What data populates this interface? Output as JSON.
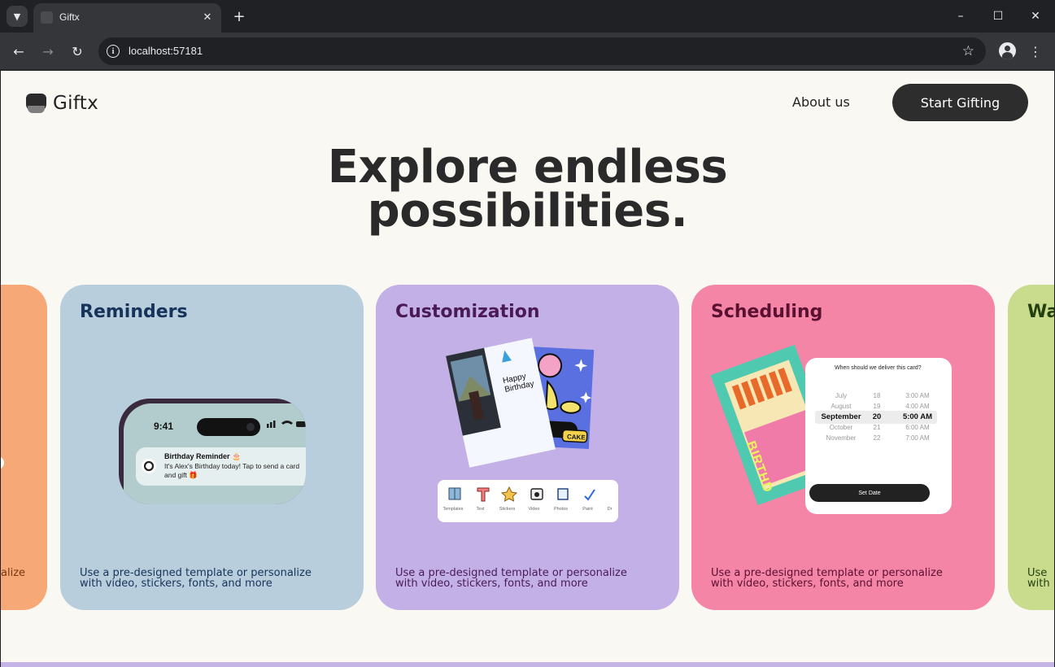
{
  "browser": {
    "tab_title": "Giftx",
    "url": "localhost:57181",
    "icons": [
      "tab-search-icon",
      "close-icon",
      "plus-icon",
      "minimize-icon",
      "maximize-icon",
      "window-close-icon",
      "back-arrow-icon",
      "forward-arrow-icon",
      "reload-icon",
      "info-icon",
      "star-icon",
      "profile-icon",
      "kebab-menu-icon"
    ]
  },
  "header": {
    "brand": "Giftx",
    "nav_about": "About us",
    "cta_label": "Start Gifting"
  },
  "hero": {
    "line1": "Explore endless",
    "line2": "possibilities."
  },
  "cards": [
    {
      "title": "",
      "desc_line1": "Use a pre-designed template or personalize",
      "desc_visible": "alize",
      "color": "#f7a877",
      "text_color": "#7a3510"
    },
    {
      "title": "Reminders",
      "desc_line1": "Use a pre-designed template or personalize",
      "desc_line2": "with video, stickers, fonts, and more",
      "color": "#b8cedd",
      "text_color": "#17335a",
      "phone": {
        "time": "9:41",
        "notif_title": "Birthday Reminder 🎂",
        "notif_body": "It's Alex's Birthday today! Tap to send a card and gift 🎁"
      }
    },
    {
      "title": "Customization",
      "desc_line1": "Use a pre-designed template or personalize",
      "desc_line2": "with video, stickers, fonts, and more",
      "color": "#c3b0e6",
      "text_color": "#4a1a55",
      "card_text": "Happy Birthday",
      "cake_text": "CAKE",
      "tools": [
        "Templates",
        "Text",
        "Stickers",
        "Video",
        "Photos",
        "Paint",
        "Dr"
      ]
    },
    {
      "title": "Scheduling",
      "desc_line1": "Use a pre-designed template or personalize",
      "desc_line2": "with video, stickers, fonts, and more",
      "color": "#f585a6",
      "text_color": "#5a1030",
      "picker": {
        "question": "When should we deliver this card?",
        "months": [
          "July",
          "August",
          "September",
          "October",
          "November"
        ],
        "days": [
          "18",
          "19",
          "20",
          "21",
          "22"
        ],
        "times": [
          "3:00 AM",
          "4:00 AM",
          "5:00 AM",
          "6:00 AM",
          "7:00 AM"
        ],
        "button": "Set Date"
      },
      "card_text": "BIRTHD"
    },
    {
      "title": "Wa",
      "desc_line1": "Use",
      "desc_line2": "with",
      "color": "#c9dc8d",
      "text_color": "#244010"
    }
  ]
}
